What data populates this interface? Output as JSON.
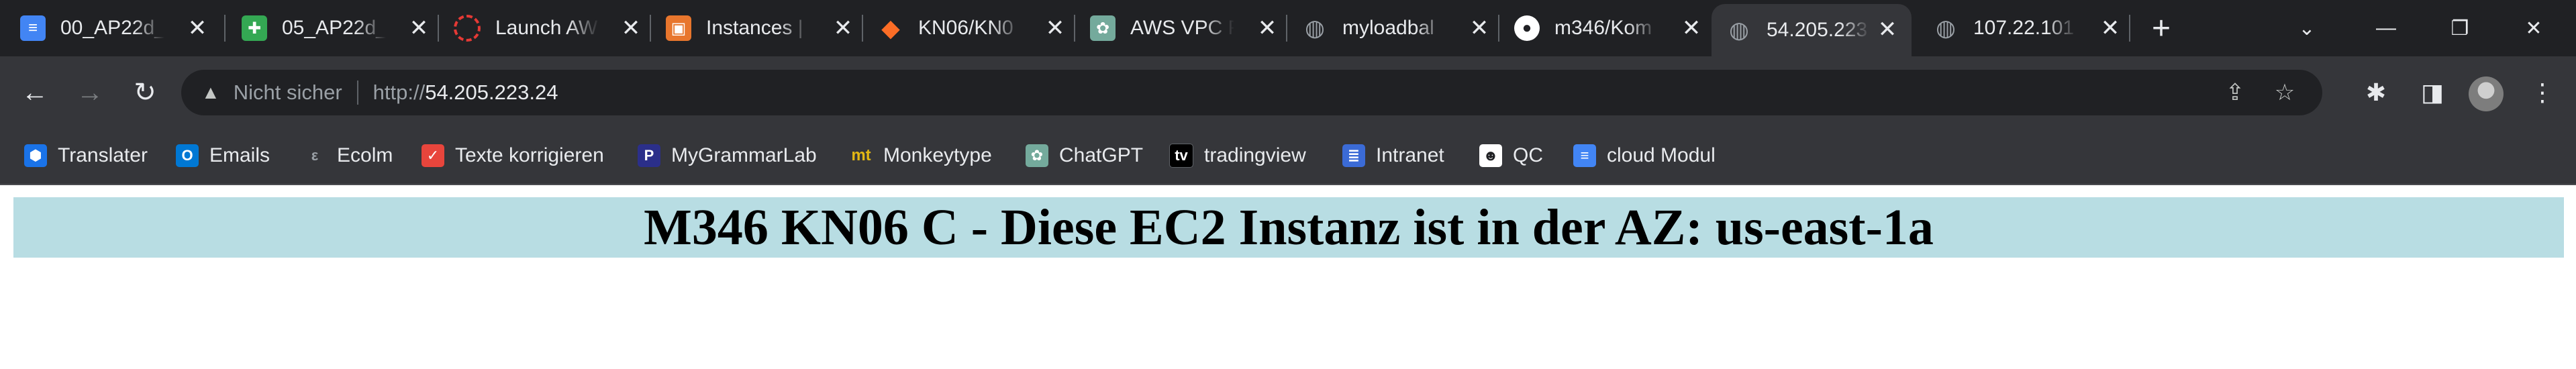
{
  "tabs": [
    {
      "title": "00_AP22d_",
      "icon": "docs-icon",
      "color": "#4285f4"
    },
    {
      "title": "05_AP22d_",
      "icon": "sheets-icon",
      "color": "#34a853"
    },
    {
      "title": "Launch AW",
      "icon": "aws-launch-icon",
      "color": "#e53935"
    },
    {
      "title": "Instances |",
      "icon": "aws-ec2-icon",
      "color": "#e8762d"
    },
    {
      "title": "KN06/KN0",
      "icon": "gitlab-icon",
      "color": "#fc6d26"
    },
    {
      "title": "AWS VPC F",
      "icon": "chatgpt-icon",
      "color": "#74aa9c"
    },
    {
      "title": "myloadbal",
      "icon": "globe-icon",
      "color": "#9aa0a6"
    },
    {
      "title": "m346/Kom",
      "icon": "github-icon",
      "color": "#ffffff"
    },
    {
      "title": "54.205.223",
      "icon": "globe-icon",
      "color": "#9aa0a6",
      "active": true
    },
    {
      "title": "107.22.101",
      "icon": "globe-icon",
      "color": "#9aa0a6"
    }
  ],
  "address_bar": {
    "security_label": "Nicht sicher",
    "url_scheme": "http://",
    "url_host": "54.205.223.24"
  },
  "bookmarks": [
    {
      "label": "Translater",
      "icon": "translater-icon",
      "color": "#1a73e8"
    },
    {
      "label": "Emails",
      "icon": "outlook-icon",
      "color": "#0078d4"
    },
    {
      "label": "Ecolm",
      "icon": "ecolm-icon",
      "color": "#5f6368"
    },
    {
      "label": "Texte korrigieren",
      "icon": "texte-icon",
      "color": "#e8453c"
    },
    {
      "label": "MyGrammarLab",
      "icon": "mygrammarlab-icon",
      "color": "#2b2f8a"
    },
    {
      "label": "Monkeytype",
      "icon": "monkeytype-icon",
      "color": "#e2b714"
    },
    {
      "label": "ChatGPT",
      "icon": "chatgpt-icon",
      "color": "#74aa9c"
    },
    {
      "label": "tradingview",
      "icon": "tradingview-icon",
      "color": "#000000"
    },
    {
      "label": "Intranet",
      "icon": "intranet-icon",
      "color": "#3b6bd6"
    },
    {
      "label": "QC",
      "icon": "qc-icon",
      "color": "#ffffff"
    },
    {
      "label": "cloud Modul",
      "icon": "docs-icon",
      "color": "#4285f4"
    }
  ],
  "page": {
    "heading": "M346 KN06 C - Diese EC2 Instanz ist in der AZ: us-east-1a"
  }
}
